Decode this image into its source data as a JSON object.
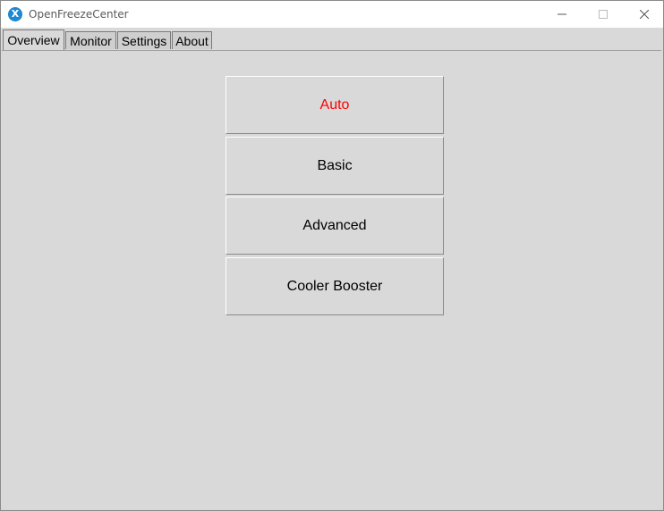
{
  "window": {
    "title": "OpenFreezeCenter",
    "app_icon_glyph": "X",
    "app_icon_color": "#1e88d4"
  },
  "tabs": [
    {
      "label": "Overview",
      "active": true
    },
    {
      "label": "Monitor",
      "active": false
    },
    {
      "label": "Settings",
      "active": false
    },
    {
      "label": "About",
      "active": false
    }
  ],
  "modes": {
    "auto": {
      "label": "Auto",
      "color": "#ff0000",
      "selected": true
    },
    "basic": {
      "label": "Basic"
    },
    "advanced": {
      "label": "Advanced"
    },
    "cooler_booster": {
      "label": "Cooler Booster"
    }
  }
}
